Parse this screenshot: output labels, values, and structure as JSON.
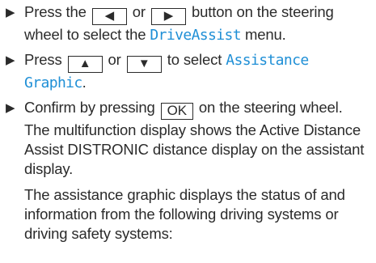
{
  "steps": [
    {
      "pre": "Press the",
      "key1": "◀",
      "mid": "or",
      "key2": "▶",
      "post": "button on the steering wheel to select the",
      "menu": "DriveAssist",
      "end": "menu."
    },
    {
      "pre": "Press",
      "key1": "▲",
      "mid": "or",
      "key2": "▼",
      "post": "to select",
      "menu": "Assistance Graphic",
      "end": "."
    },
    {
      "pre": "Confirm by pressing",
      "key": "OK",
      "post": "on the steering wheel."
    }
  ],
  "paragraphs": [
    "The multifunction display shows the Active Distance Assist DISTRONIC distance display on the assistant display.",
    "The assistance graphic displays the status of and information from the following driving systems or driving safety systems:"
  ]
}
